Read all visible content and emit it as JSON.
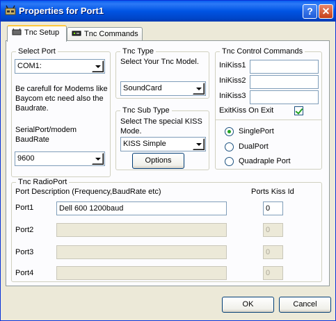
{
  "window": {
    "title": "Properties for Port1",
    "help_glyph": "?",
    "close_glyph": "✕"
  },
  "tabs": [
    {
      "label": "Tnc Setup",
      "icon": "tnc-setup-icon"
    },
    {
      "label": "Tnc Commands",
      "icon": "tnc-commands-icon"
    }
  ],
  "select_port": {
    "legend": "Select Port",
    "value": "COM1:",
    "warning": "Be carefull for Modems like Baycom etc need also the Baudrate.",
    "baud_label": "SerialPort/modem BaudRate",
    "baud_value": "9600"
  },
  "tnc_type": {
    "legend": "Tnc Type",
    "description": "Select Your Tnc Model.",
    "value": "SoundCard"
  },
  "tnc_sub_type": {
    "legend": "Tnc Sub Type",
    "description": "Select The special KISS Mode.",
    "value": "KISS Simple",
    "options_button": "Options"
  },
  "control": {
    "legend": "Tnc Control Commands",
    "kiss1_label": "IniKiss1",
    "kiss2_label": "IniKiss2",
    "kiss3_label": "IniKiss3",
    "kiss1_value": "",
    "kiss2_value": "",
    "kiss3_value": "",
    "exit_label": "ExitKiss On Exit",
    "exit_checked": true,
    "radio_single": "SinglePort",
    "radio_dual": "DualPort",
    "radio_quad": "Quadraple Port",
    "selected": "SinglePort"
  },
  "radio_port": {
    "legend": "Tnc RadioPort",
    "desc_header": "Port Description (Frequency,BaudRate etc)",
    "kiss_header": "Ports Kiss Id",
    "ports": [
      {
        "label": "Port1",
        "description": "Dell 600 1200baud",
        "kiss_id": "0",
        "enabled": true
      },
      {
        "label": "Port2",
        "description": "",
        "kiss_id": "0",
        "enabled": false
      },
      {
        "label": "Port3",
        "description": "",
        "kiss_id": "0",
        "enabled": false
      },
      {
        "label": "Port4",
        "description": "",
        "kiss_id": "0",
        "enabled": false
      }
    ]
  },
  "footer": {
    "ok": "OK",
    "cancel": "Cancel"
  }
}
